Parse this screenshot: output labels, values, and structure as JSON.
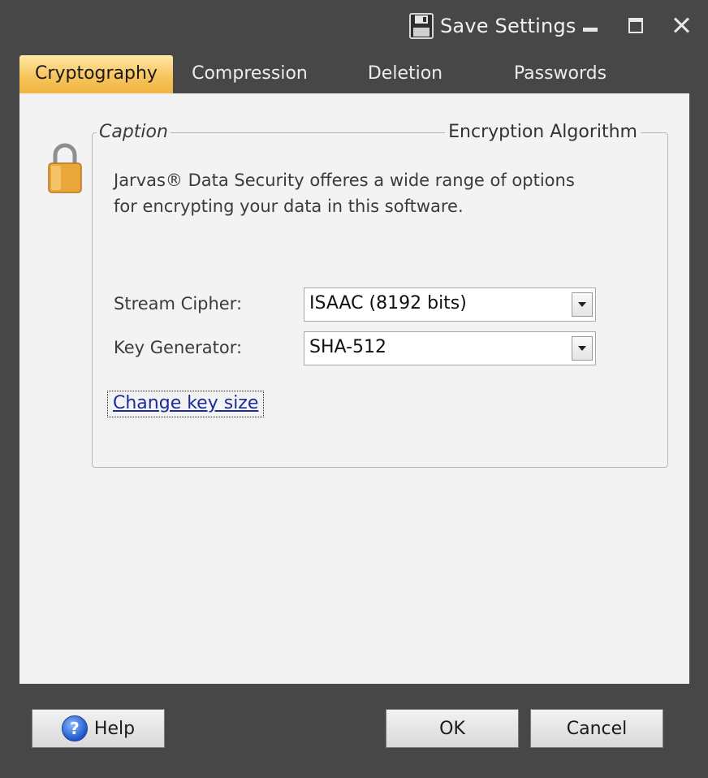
{
  "titlebar": {
    "save_label": "Save Settings",
    "save_icon": "floppy-disk-icon"
  },
  "tabs": [
    {
      "label": "Cryptography",
      "active": true
    },
    {
      "label": "Compression",
      "active": false
    },
    {
      "label": "Deletion",
      "active": false
    },
    {
      "label": "Passwords",
      "active": false
    }
  ],
  "group": {
    "caption": "Caption",
    "title": "Encryption Algorithm",
    "description_line1": "Jarvas® Data Security offeres a wide range of options",
    "description_line2": "for encrypting your data in this software."
  },
  "fields": {
    "stream_cipher_label": "Stream Cipher:",
    "stream_cipher_value": "ISAAC (8192 bits)",
    "key_generator_label": "Key Generator:",
    "key_generator_value": "SHA-512"
  },
  "link": {
    "change_key_size": "Change key size"
  },
  "buttons": {
    "help": "Help",
    "ok": "OK",
    "cancel": "Cancel"
  },
  "colors": {
    "window_bg": "#474747",
    "content_bg": "#f3f3f3",
    "active_tab": "#f7c55e",
    "link": "#1a2b9c"
  }
}
